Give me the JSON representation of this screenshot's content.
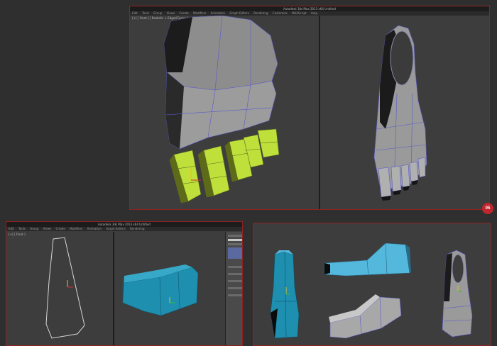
{
  "panel_main": {
    "title": "Autodesk 3ds Max 2013  x64   Untitled",
    "menu": [
      "Edit",
      "Tools",
      "Group",
      "Views",
      "Create",
      "Modifiers",
      "Animation",
      "Graph Editors",
      "Rendering",
      "Customize",
      "MAXScript",
      "Help"
    ],
    "viewport_label": "[+] [ Front ] [ Realistic + Edged Faces ]",
    "step_badge": "05"
  },
  "panel_bottom_left": {
    "title": "Autodesk 3ds Max 2013  x64   Untitled",
    "menu": [
      "Edit",
      "Tools",
      "Group",
      "Views",
      "Create",
      "Modifiers",
      "Animation",
      "Graph Editors",
      "Rendering"
    ],
    "viewport_label": "[+] [ Front ]"
  },
  "colors": {
    "frame_red": "#8f2222",
    "toe_green": "#bfe03a",
    "mesh_grey": "#8a8a8a",
    "mesh_teal": "#1f8fb0",
    "mesh_blue": "#54b8dc",
    "badge_red": "#c0262d"
  }
}
